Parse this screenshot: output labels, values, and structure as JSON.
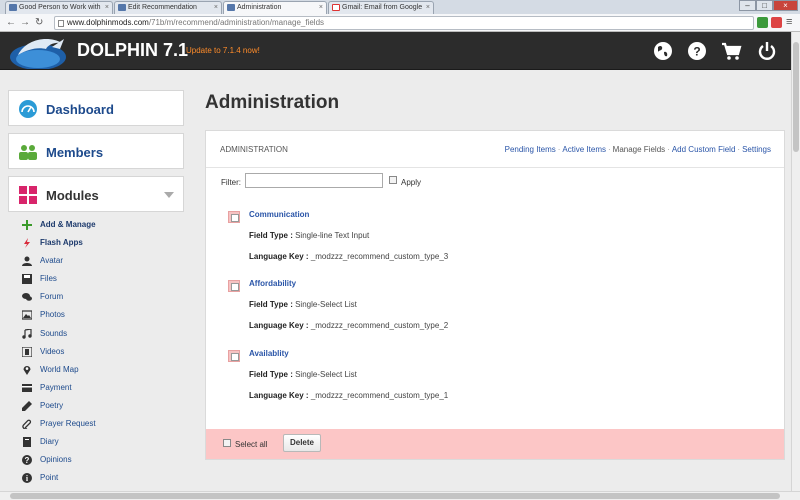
{
  "browser": {
    "tabs": [
      {
        "label": "Good Person to Work with"
      },
      {
        "label": "Edit Recommendation"
      },
      {
        "label": "Administration"
      },
      {
        "label": "Gmail: Email from Google"
      }
    ],
    "url_host": "www.dolphinmods.com",
    "url_path": "/71b/m/recommend/administration/manage_fields"
  },
  "header": {
    "brand": "DOLPHIN 7.1",
    "update_link": "Update to 7.1.4 now!",
    "icons": [
      "globe-icon",
      "help-icon",
      "cart-icon",
      "power-icon"
    ]
  },
  "sidebar": {
    "panels": [
      {
        "label": "Dashboard",
        "icon": "speedometer-icon",
        "color": "#2b9bd6"
      },
      {
        "label": "Members",
        "icon": "members-icon",
        "color": "#5aaa3a"
      },
      {
        "label": "Modules",
        "icon": "modules-icon",
        "color": "#d8256b"
      }
    ],
    "modules": [
      {
        "label": "Add & Manage",
        "icon": "plus-icon"
      },
      {
        "label": "Flash Apps",
        "icon": "flash-icon"
      },
      {
        "label": "Avatar",
        "icon": "user-icon"
      },
      {
        "label": "Files",
        "icon": "floppy-icon"
      },
      {
        "label": "Forum",
        "icon": "chat-icon"
      },
      {
        "label": "Photos",
        "icon": "picture-icon"
      },
      {
        "label": "Sounds",
        "icon": "music-icon"
      },
      {
        "label": "Videos",
        "icon": "film-icon"
      },
      {
        "label": "World Map",
        "icon": "map-marker-icon"
      },
      {
        "label": "Payment",
        "icon": "credit-card-icon"
      },
      {
        "label": "Poetry",
        "icon": "pencil-icon"
      },
      {
        "label": "Prayer Request",
        "icon": "paperclip-icon"
      },
      {
        "label": "Diary",
        "icon": "book-icon"
      },
      {
        "label": "Opinions",
        "icon": "question-icon"
      },
      {
        "label": "Point",
        "icon": "info-icon"
      }
    ]
  },
  "main": {
    "page_title": "Administration",
    "box_title": "ADMINISTRATION",
    "submenu": [
      {
        "label": "Pending Items"
      },
      {
        "label": "Active Items"
      },
      {
        "label": "Manage Fields"
      },
      {
        "label": "Add Custom Field"
      },
      {
        "label": "Settings"
      }
    ],
    "filter_label": "Filter:",
    "filter_value": "",
    "apply_label": "Apply",
    "field_type_label": "Field Type :",
    "language_key_label": "Language Key :",
    "fields": [
      {
        "name": "Communication",
        "type": "Single-line Text Input",
        "key": "_modzzz_recommend_custom_type_3"
      },
      {
        "name": "Affordability",
        "type": "Single-Select List",
        "key": "_modzzz_recommend_custom_type_2"
      },
      {
        "name": "Availablity",
        "type": "Single-Select List",
        "key": "_modzzz_recommend_custom_type_1"
      }
    ],
    "select_all_label": "Select all",
    "delete_label": "Delete"
  }
}
